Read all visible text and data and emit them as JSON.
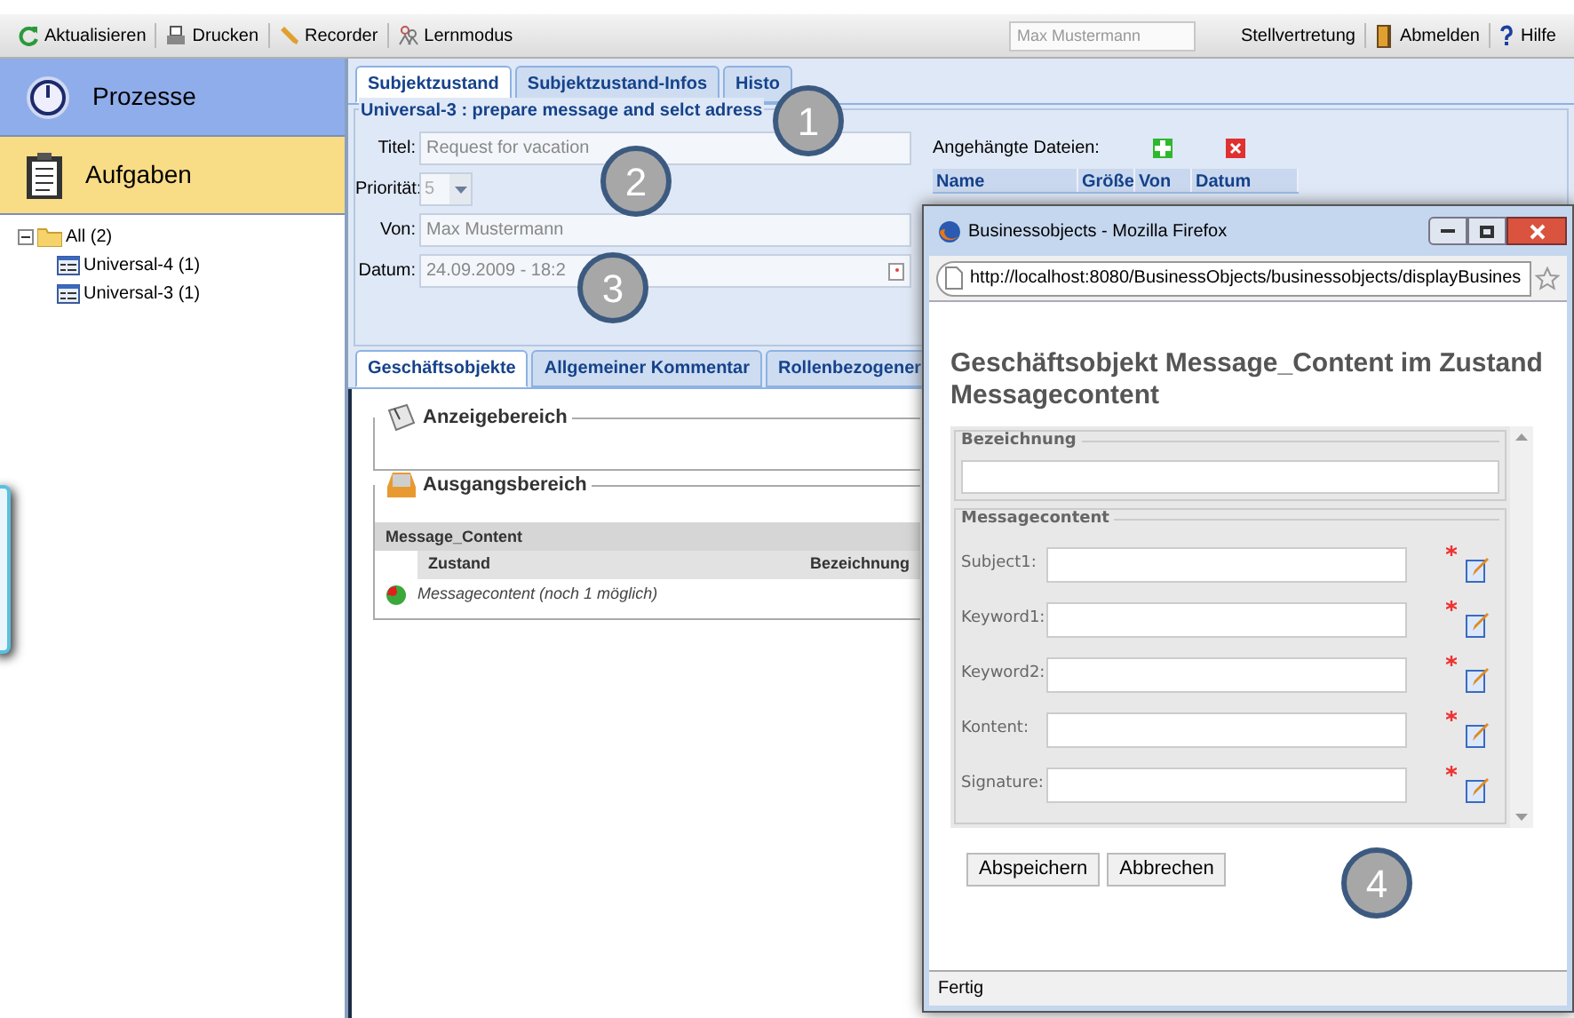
{
  "toolbar": {
    "buttons": [
      {
        "label": "Aktualisieren",
        "kind": "refresh"
      },
      {
        "label": "Drucken",
        "kind": "print"
      },
      {
        "label": "Recorder",
        "kind": "pencil"
      },
      {
        "label": "Lernmodus",
        "kind": "learn"
      }
    ],
    "user_field": {
      "placeholder": "Max Mustermann"
    },
    "right_buttons": [
      {
        "label": "Stellvertretung",
        "kind": "text"
      },
      {
        "label": "Abmelden",
        "kind": "door"
      },
      {
        "label": "Hilfe",
        "kind": "help"
      }
    ]
  },
  "sidebar": {
    "nav": [
      {
        "label": "Prozesse",
        "kind": "clock",
        "selected": false
      },
      {
        "label": "Aufgaben",
        "kind": "clipboard",
        "selected": true
      }
    ],
    "tree": [
      {
        "label": "All (2)",
        "expanded": true,
        "children": [
          {
            "label": "Universal-4 (1)"
          },
          {
            "label": "Universal-3 (1)"
          }
        ]
      }
    ]
  },
  "tabs": [
    {
      "label": "Subjektzustand",
      "selected": true
    },
    {
      "label": "Subjektzustand-Infos",
      "selected": false
    },
    {
      "label": "Histo",
      "selected": false
    }
  ],
  "form": {
    "legend": "Universal-3 : prepare message and selct adress",
    "fields": [
      {
        "label": "Titel:",
        "value": "Request for vacation",
        "kind": "text"
      },
      {
        "label": "Priorität:",
        "value": "5",
        "kind": "select"
      },
      {
        "label": "Von:",
        "value": "Max Mustermann",
        "kind": "text"
      },
      {
        "label": "Datum:",
        "value": "24.09.2009 - 18:2",
        "kind": "date"
      }
    ],
    "attachments": {
      "label": "Angehängte Dateien:",
      "columns": [
        "Name",
        "Größe",
        "Von",
        "Datum"
      ]
    }
  },
  "lower_tabs": [
    {
      "label": "Geschäftsobjekte",
      "selected": true
    },
    {
      "label": "Allgemeiner Kommentar",
      "selected": false
    },
    {
      "label": "Rollenbezogener",
      "selected": false
    }
  ],
  "sections": [
    {
      "title": "Anzeigebereich",
      "kind": "display"
    },
    {
      "title": "Ausgangsbereich",
      "kind": "outbox",
      "table": {
        "title": "Message_Content",
        "columns": [
          "Zustand",
          "Bezeichnung"
        ],
        "rows": [
          "Messagecontent (noch 1 möglich)"
        ]
      }
    }
  ],
  "popup": {
    "title": "Businessobjects - Mozilla Firefox",
    "url": "http://localhost:8080/BusinessObjects/businessobjects/displayBusines",
    "heading": "Geschäftsobjekt Message_Content im Zustand Messagecontent",
    "groups": [
      {
        "legend": "Bezeichnung"
      },
      {
        "legend": "Messagecontent",
        "fields": [
          {
            "label": "Subject1:",
            "required": true
          },
          {
            "label": "Keyword1:",
            "required": true
          },
          {
            "label": "Keyword2:",
            "required": true
          },
          {
            "label": "Kontent:",
            "required": true
          },
          {
            "label": "Signature:",
            "required": true
          }
        ]
      }
    ],
    "buttons": [
      "Abspeichern",
      "Abbrechen"
    ],
    "status": "Fertig"
  },
  "callouts": [
    "1",
    "2",
    "3",
    "4"
  ]
}
